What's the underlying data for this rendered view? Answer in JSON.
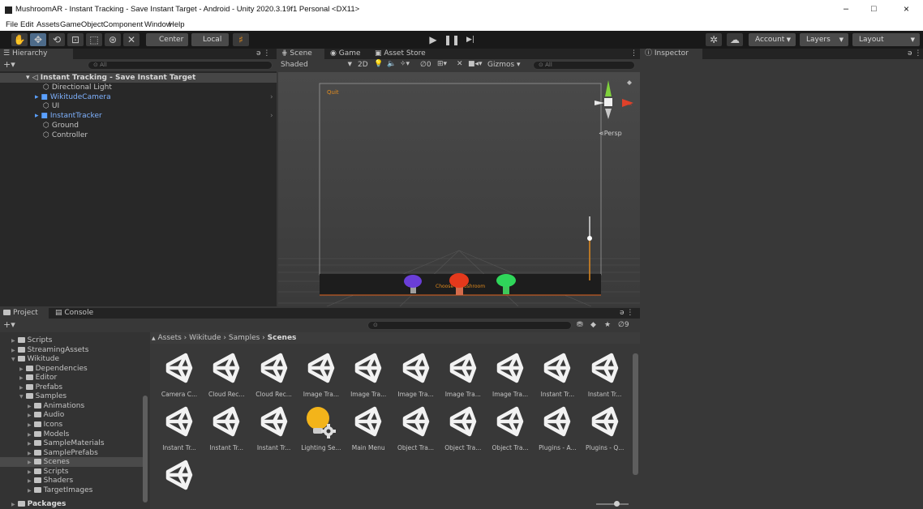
{
  "window": {
    "title": "MushroomAR - Instant Tracking - Save Instant Target - Android - Unity 2020.3.19f1 Personal <DX11>",
    "minimize": "–",
    "maximize": "□",
    "close": "×"
  },
  "menu": [
    "File",
    "Edit",
    "Assets",
    "GameObject",
    "Component",
    "Window",
    "Help"
  ],
  "toolbar": {
    "pivot": "Center",
    "space": "Local",
    "account": "Account",
    "layers": "Layers",
    "layout": "Layout"
  },
  "hierarchy": {
    "tab": "Hierarchy",
    "search_placeholder": "All",
    "scene": "Instant Tracking - Save Instant Target",
    "items": [
      {
        "label": "Directional Light",
        "prefab": false
      },
      {
        "label": "WikitudeCamera",
        "prefab": true
      },
      {
        "label": "UI",
        "prefab": false
      },
      {
        "label": "InstantTracker",
        "prefab": true
      },
      {
        "label": "Ground",
        "prefab": false
      },
      {
        "label": "Controller",
        "prefab": false
      }
    ]
  },
  "scene_view": {
    "tabs": [
      "Scene",
      "Game",
      "Asset Store"
    ],
    "shading": "Shaded",
    "mode_2d": "2D",
    "fx_count": "0",
    "gizmos": "Gizmos",
    "search_placeholder": "All",
    "ui_quit": "Quit",
    "ui_choose": "Choose a Mushroom",
    "persp": "Persp",
    "axis_x": "x"
  },
  "inspector": {
    "tab": "Inspector"
  },
  "project": {
    "tabs": [
      "Project",
      "Console"
    ],
    "hidden_count": "9",
    "tree": [
      {
        "label": "Scripts",
        "indent": 0
      },
      {
        "label": "StreamingAssets",
        "indent": 0
      },
      {
        "label": "Wikitude",
        "indent": 0,
        "open": true
      },
      {
        "label": "Dependencies",
        "indent": 1
      },
      {
        "label": "Editor",
        "indent": 1
      },
      {
        "label": "Prefabs",
        "indent": 1
      },
      {
        "label": "Samples",
        "indent": 1,
        "open": true
      },
      {
        "label": "Animations",
        "indent": 2
      },
      {
        "label": "Audio",
        "indent": 2
      },
      {
        "label": "Icons",
        "indent": 2
      },
      {
        "label": "Models",
        "indent": 2
      },
      {
        "label": "SampleMaterials",
        "indent": 2
      },
      {
        "label": "SamplePrefabs",
        "indent": 2
      },
      {
        "label": "Scenes",
        "indent": 2,
        "selected": true
      },
      {
        "label": "Scripts",
        "indent": 2
      },
      {
        "label": "Shaders",
        "indent": 2
      },
      {
        "label": "TargetImages",
        "indent": 2
      },
      {
        "label": "Packages",
        "indent": 0,
        "bold": true
      }
    ],
    "breadcrumb": [
      "Assets",
      "Wikitude",
      "Samples",
      "Scenes"
    ],
    "assets": [
      {
        "label": "Camera C...",
        "type": "unity"
      },
      {
        "label": "Cloud Rec...",
        "type": "unity"
      },
      {
        "label": "Cloud Rec...",
        "type": "unity"
      },
      {
        "label": "Image Tra...",
        "type": "unity"
      },
      {
        "label": "Image Tra...",
        "type": "unity"
      },
      {
        "label": "Image Tra...",
        "type": "unity"
      },
      {
        "label": "Image Tra...",
        "type": "unity"
      },
      {
        "label": "Image Tra...",
        "type": "unity"
      },
      {
        "label": "Instant Tr...",
        "type": "unity"
      },
      {
        "label": "Instant Tr...",
        "type": "unity"
      },
      {
        "label": "Instant Tr...",
        "type": "unity"
      },
      {
        "label": "Instant Tr...",
        "type": "unity"
      },
      {
        "label": "Instant Tr...",
        "type": "unity"
      },
      {
        "label": "Lighting Se...",
        "type": "lighting"
      },
      {
        "label": "Main Menu",
        "type": "unity"
      },
      {
        "label": "Object Tra...",
        "type": "unity"
      },
      {
        "label": "Object Tra...",
        "type": "unity"
      },
      {
        "label": "Object Tra...",
        "type": "unity"
      },
      {
        "label": "Plugins - A...",
        "type": "unity"
      },
      {
        "label": "Plugins - Q...",
        "type": "unity"
      },
      {
        "label": "",
        "type": "unity"
      }
    ]
  },
  "colors": {
    "accent_blue": "#7fb2ff",
    "selection": "#2c5d87",
    "ui_orange": "#e08a1e"
  }
}
